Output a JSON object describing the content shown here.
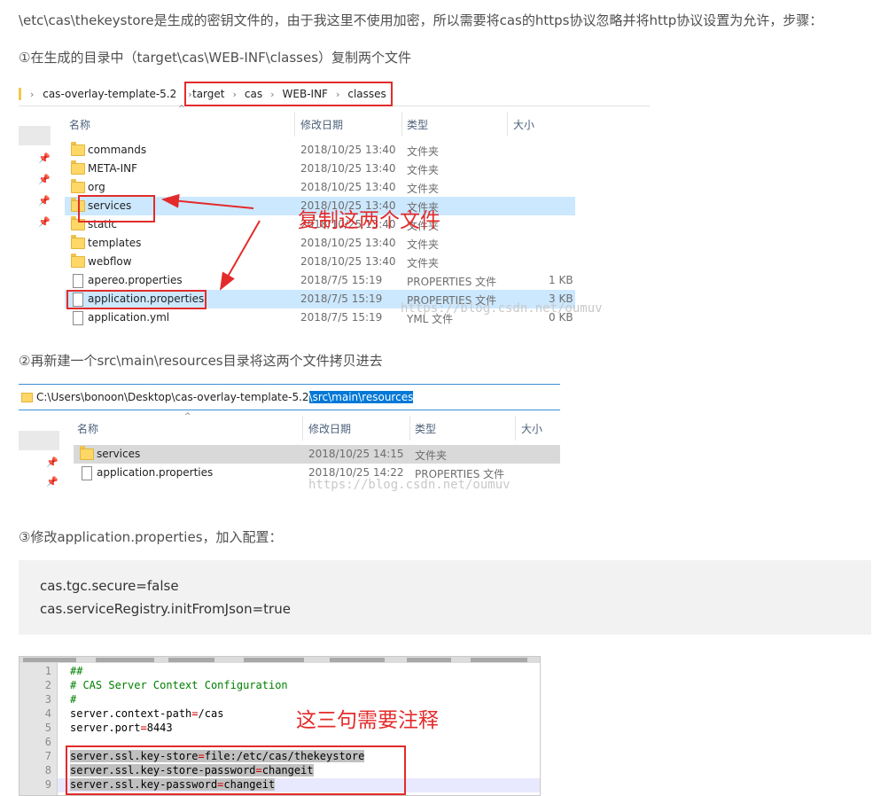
{
  "intro": "\\etc\\cas\\thekeystore是生成的密钥文件的，由于我这里不使用加密，所以需要将cas的https协议忽略并将http协议设置为允许，步骤：",
  "step1": "①在生成的目录中（target\\cas\\WEB-INF\\classes）复制两个文件",
  "step2": "②再新建一个src\\main\\resources目录将这两个文件拷贝进去",
  "step3": "③修改application.properties，加入配置：",
  "explorer1": {
    "breadcrumb_root": "cas-overlay-template-5.2",
    "breadcrumb": [
      "target",
      "cas",
      "WEB-INF",
      "classes"
    ],
    "columns": {
      "name": "名称",
      "date": "修改日期",
      "type": "类型",
      "size": "大小"
    },
    "rows": [
      {
        "name": "commands",
        "date": "2018/10/25 13:40",
        "type": "文件夹",
        "size": "",
        "kind": "folder"
      },
      {
        "name": "META-INF",
        "date": "2018/10/25 13:40",
        "type": "文件夹",
        "size": "",
        "kind": "folder"
      },
      {
        "name": "org",
        "date": "2018/10/25 13:40",
        "type": "文件夹",
        "size": "",
        "kind": "folder"
      },
      {
        "name": "services",
        "date": "2018/10/25 13:40",
        "type": "文件夹",
        "size": "",
        "kind": "folder"
      },
      {
        "name": "static",
        "date": "2018/10/25 13:40",
        "type": "文件夹",
        "size": "",
        "kind": "folder"
      },
      {
        "name": "templates",
        "date": "2018/10/25 13:40",
        "type": "文件夹",
        "size": "",
        "kind": "folder"
      },
      {
        "name": "webflow",
        "date": "2018/10/25 13:40",
        "type": "文件夹",
        "size": "",
        "kind": "folder"
      },
      {
        "name": "apereo.properties",
        "date": "2018/7/5 15:19",
        "type": "PROPERTIES 文件",
        "size": "1 KB",
        "kind": "file"
      },
      {
        "name": "application.properties",
        "date": "2018/7/5 15:19",
        "type": "PROPERTIES 文件",
        "size": "3 KB",
        "kind": "file"
      },
      {
        "name": "application.yml",
        "date": "2018/7/5 15:19",
        "type": "YML 文件",
        "size": "0 KB",
        "kind": "file"
      }
    ],
    "annotation": "复制这两个文件",
    "watermark": "https://blog.csdn.net/oumuv"
  },
  "explorer2": {
    "path_prefix": "C:\\Users\\bonoon\\Desktop\\cas-overlay-template-5.2",
    "path_selected": "\\src\\main\\resources",
    "columns": {
      "name": "名称",
      "date": "修改日期",
      "type": "类型",
      "size": "大小"
    },
    "rows": [
      {
        "name": "services",
        "date": "2018/10/25 14:15",
        "type": "文件夹",
        "kind": "folder"
      },
      {
        "name": "application.properties",
        "date": "2018/10/25 14:22",
        "type": "PROPERTIES 文件",
        "kind": "file"
      }
    ],
    "watermark": "https://blog.csdn.net/oumuv"
  },
  "config": [
    "cas.tgc.secure=false",
    "cas.serviceRegistry.initFromJson=true"
  ],
  "editor": {
    "annotation": "这三句需要注释",
    "lines": [
      {
        "num": "1",
        "text": "##"
      },
      {
        "num": "2",
        "text": "# CAS Server Context Configuration"
      },
      {
        "num": "3",
        "text": "#"
      },
      {
        "num": "4",
        "key": "server.context-path",
        "value": "/cas"
      },
      {
        "num": "5",
        "key": "server.port",
        "value": "8443"
      },
      {
        "num": "6",
        "text": ""
      },
      {
        "num": "7",
        "key": "server.ssl.key-store",
        "value": "file:/etc/cas/thekeystore"
      },
      {
        "num": "8",
        "key": "server.ssl.key-store-password",
        "value": "changeit"
      },
      {
        "num": "9",
        "key": "server.ssl.key-password",
        "value": "changeit"
      }
    ]
  },
  "colors": {
    "annotation_red": "#e32b2b",
    "selection_blue": "#cce8ff",
    "code_bg": "#f2f2f2"
  }
}
